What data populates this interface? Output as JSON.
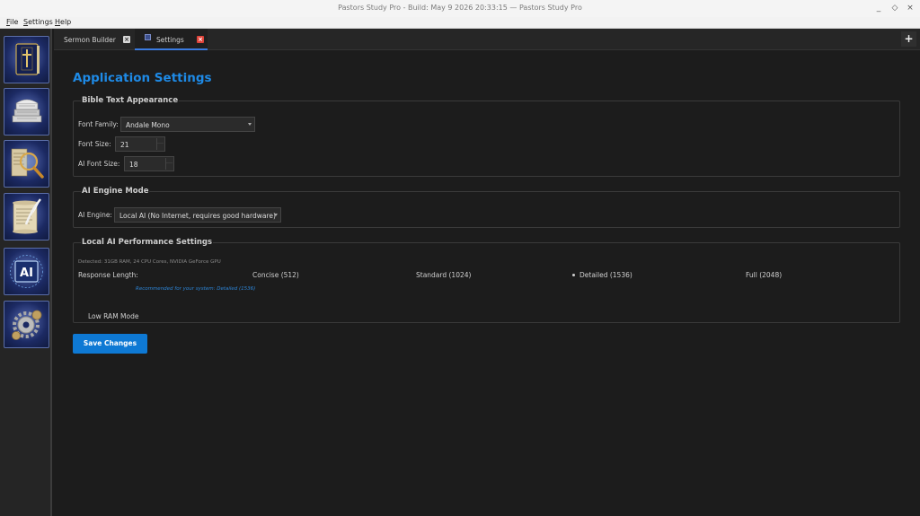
{
  "window": {
    "title": "Pastors Study Pro - Build: May  9 2026 20:33:15 — Pastors Study Pro",
    "controls": {
      "minimize": "_",
      "restore": "◇",
      "close": "×"
    }
  },
  "menu": [
    {
      "label": "File",
      "underline": "F",
      "rest": "ile"
    },
    {
      "label": "Settings",
      "underline": "S",
      "rest": "ettings"
    },
    {
      "label": "Help",
      "underline": "H",
      "rest": "elp"
    }
  ],
  "sidebar": {
    "items": [
      {
        "icon": "bible-book-icon"
      },
      {
        "icon": "library-books-icon"
      },
      {
        "icon": "magnifier-scroll-icon"
      },
      {
        "icon": "quill-scroll-icon"
      },
      {
        "icon": "ai-chip-icon",
        "text": "AI"
      },
      {
        "icon": "gears-icon"
      }
    ]
  },
  "tabs": [
    {
      "label": "Sermon Builder",
      "close": "×",
      "active": false
    },
    {
      "label": "Settings",
      "close": "×",
      "active": true
    }
  ],
  "new_tab": "+",
  "settings": {
    "title": "Application Settings",
    "bible_text": {
      "group_title": "Bible Text Appearance",
      "font_family_label": "Font Family:",
      "font_family_value": "Andale Mono",
      "font_size_label": "Font Size:",
      "font_size_value": "21",
      "ai_font_size_label": "AI Font Size:",
      "ai_font_size_value": "18"
    },
    "ai_engine": {
      "group_title": "AI Engine Mode",
      "engine_label": "AI Engine:",
      "engine_value": "Local AI (No Internet, requires good hardware)"
    },
    "local_ai": {
      "group_title": "Local AI Performance Settings",
      "detected": "Detected: 31GB RAM, 24 CPU Cores, NVIDIA GeForce GPU",
      "response_length_label": "Response Length:",
      "options": [
        "Concise (512)",
        "Standard (1024)",
        "Detailed (1536)",
        "Full (2048)"
      ],
      "selected": "Detailed (1536)",
      "recommendation": "Recommended for your system: Detailed (1536)",
      "low_ram_label": "Low RAM Mode"
    },
    "save_label": "Save Changes"
  },
  "colors": {
    "accent": "#1e8ae6",
    "save_button": "#0e79d4",
    "background": "#1c1c1c",
    "tab_close_gray": "#d8d8d8",
    "tab_close_red": "#e0443a"
  }
}
